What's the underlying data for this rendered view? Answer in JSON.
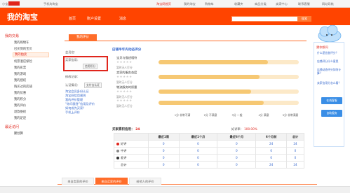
{
  "topbar": {
    "greeting": "小宝",
    "mobile": "手机淘淘宝",
    "taobao_home": "淘宝网首页",
    "my_taobao": "我的淘宝",
    "cart": "购物车",
    "favorites": "收藏夹",
    "products": "商品分类",
    "seller_center": "卖家中心",
    "contact": "联系客服",
    "sitemap": "网站导航"
  },
  "header": {
    "logo": "我的淘宝",
    "nav": [
      "首页",
      "账户设置",
      "消息"
    ],
    "search_button": "搜索"
  },
  "sidebar": {
    "sections": [
      {
        "title": "我的交易",
        "items": [
          "我的购物车",
          "已买到的宝贝",
          "我的拍卖",
          "机票酒店保险",
          "我的彩票",
          "我的游戏",
          "我的授权",
          "购买过的店铺",
          "我的优惠",
          "我的积分",
          "我的评价",
          "退款维权",
          "我的足迹"
        ]
      },
      {
        "title": "最近访问",
        "items": [
          "聚划算"
        ]
      }
    ],
    "active": "我的评价"
  },
  "main": {
    "active_tab": "我的评价",
    "profile": {
      "member_label": "会员名：",
      "level_label": "买家信用：",
      "credit_badge": "信用积分",
      "verify_label": "认证情况：",
      "verify_badge": "支付宝认证",
      "history_label": "修改记录：",
      "links": [
        "淘宝会员身份认证",
        "淘宝网信用规则",
        "我的评价管理",
        "“你问我答”信用及评价",
        "如何成为买家？",
        "手机上评价"
      ]
    },
    "rating": {
      "title": "店铺半年内动态评分",
      "rows": [
        {
          "label": "宝贝与描述相符",
          "sub": "暂时无人打分",
          "fill": 0.78
        },
        {
          "label": "卖家的服务态度",
          "sub": "暂时无人打分",
          "fill": 0.72
        },
        {
          "label": "物流服务的质量",
          "sub": "暂时无人打分",
          "fill": 0.66
        },
        {
          "label": "",
          "sub": "暂时无人打分",
          "fill": 0.75
        }
      ],
      "scale": [
        "1分 非常不满",
        "2分 不满意",
        "3分 一般",
        "4分 满意",
        "5分 非常满意"
      ]
    },
    "stats": {
      "title": "买家累积信用：",
      "score": "24",
      "total_label": "好评率：",
      "total_value": "100.00%",
      "headers": [
        "",
        "最近1周",
        "最近1个月",
        "最近6个月",
        "6个月前",
        "总计"
      ],
      "rows": [
        {
          "label": "好评",
          "color": "#e0251c",
          "values": [
            "0",
            "0",
            "0",
            "24",
            "24"
          ]
        },
        {
          "label": "中评",
          "color": "#888888",
          "values": [
            "0",
            "0",
            "0",
            "0",
            "0"
          ]
        },
        {
          "label": "差评",
          "color": "#333333",
          "values": [
            "0",
            "0",
            "0",
            "0",
            "0"
          ]
        },
        {
          "label": "总计",
          "color": "",
          "values": [
            "0",
            "0",
            "0",
            "24",
            "24"
          ]
        }
      ]
    },
    "bottom_tabs": [
      "来自卖家的评价",
      "来自买家的评价",
      "给他人的评价"
    ],
    "bottom_active": 1
  },
  "help": {
    "title": "猜你想问",
    "questions": [
      "什么是信誉评分？",
      "店铺评分什么意思",
      "店铺动态评分如何计算？",
      "卖家信用分怎么看？"
    ],
    "buttons": [
      "在线客服",
      "自助服务"
    ]
  },
  "colors": {
    "brand": "#ff4400",
    "link": "#3366cc",
    "accent": "#e0251c"
  }
}
